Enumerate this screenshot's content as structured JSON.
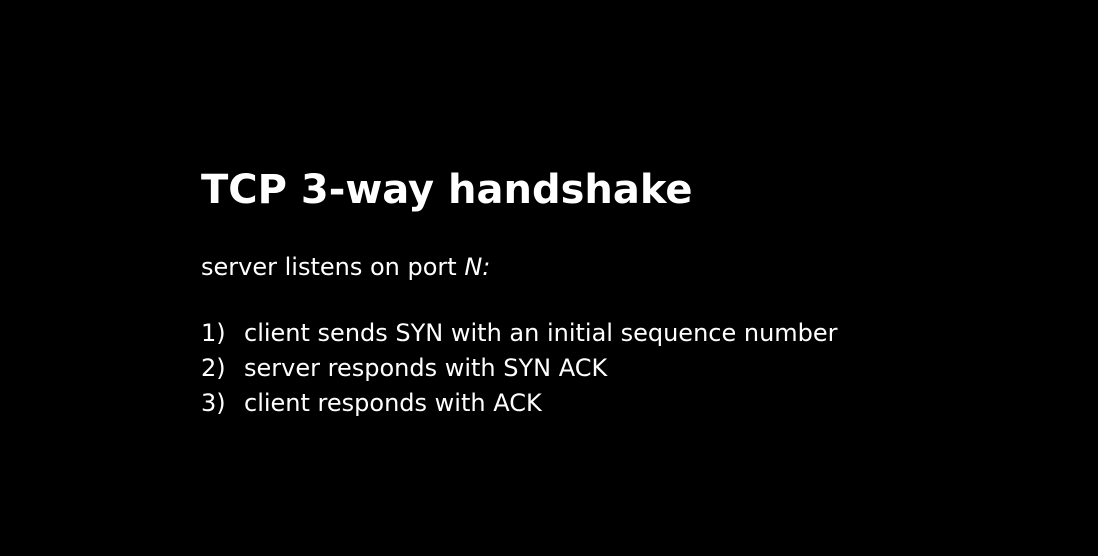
{
  "slide": {
    "background": "#000000",
    "text_color": "#ffffff",
    "title": "TCP 3-way handshake",
    "subtitle_prefix": "server listens on port ",
    "subtitle_port": "N:",
    "steps": [
      {
        "num": "1)",
        "text": "client sends SYN with an initial sequence number"
      },
      {
        "num": "2)",
        "text": "server responds with SYN ACK"
      },
      {
        "num": "3)",
        "text": "client responds with ACK"
      }
    ]
  }
}
